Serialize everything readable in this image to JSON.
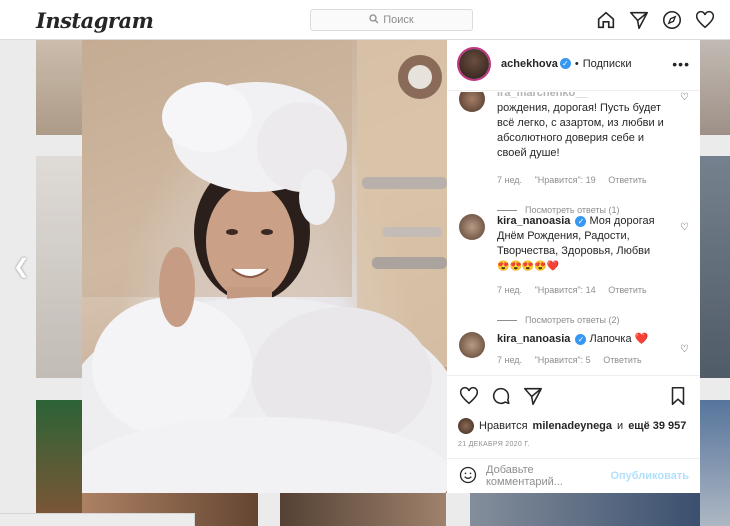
{
  "nav": {
    "logo": "Instagram",
    "search_placeholder": "Поиск"
  },
  "post": {
    "username": "achekhova",
    "separator": "•",
    "follow_label": "Подписки",
    "more_label": "•••",
    "comments": [
      {
        "username": "ira_marchenko__",
        "text": "С днём рождения, дорогая! Пусть будет всё легко, с азартом, из любви и абсолютного доверия себе и своей душе!",
        "text_visible": "рождения, дорогая! Пусть будет всё легко, с азартом, из любви и абсолютного доверия себе и своей душе!",
        "age": "7 нед.",
        "likes": "\"Нравится\": 19",
        "reply": "Ответить",
        "view_replies": "Посмотреть ответы (1)"
      },
      {
        "username": "kira_nanoasia",
        "text": "Моя дорогая, с Днём Рождения, Радости, Творчества, Здоровья, Любви",
        "text_visible": "Моя дорогая",
        "text_line2": "Днём Рождения, Радости,",
        "text_line3": "Творчества, Здоровья, Любви",
        "emoji": "😍😍😍😍❤️",
        "age": "7 нед.",
        "likes": "\"Нравится\": 14",
        "reply": "Ответить",
        "view_replies": "Посмотреть ответы (2)"
      },
      {
        "username": "kira_nanoasia",
        "text": "Лапочка",
        "emoji": "❤️",
        "age": "7 нед.",
        "likes": "\"Нравится\": 5",
        "reply": "Ответить"
      }
    ],
    "likes_prefix": "Нравится",
    "likes_user": "milenadeynega",
    "likes_mid": "и",
    "likes_count": "ещё 39 957",
    "date": "21 ДЕКАБРЯ 2020 Г.",
    "add_comment_placeholder": "Добавьте комментарий...",
    "publish_label": "Опубликовать"
  },
  "colors": {
    "verified": "#3897f0",
    "publish": "#b2dffc",
    "heart_red": "#ed4956"
  }
}
